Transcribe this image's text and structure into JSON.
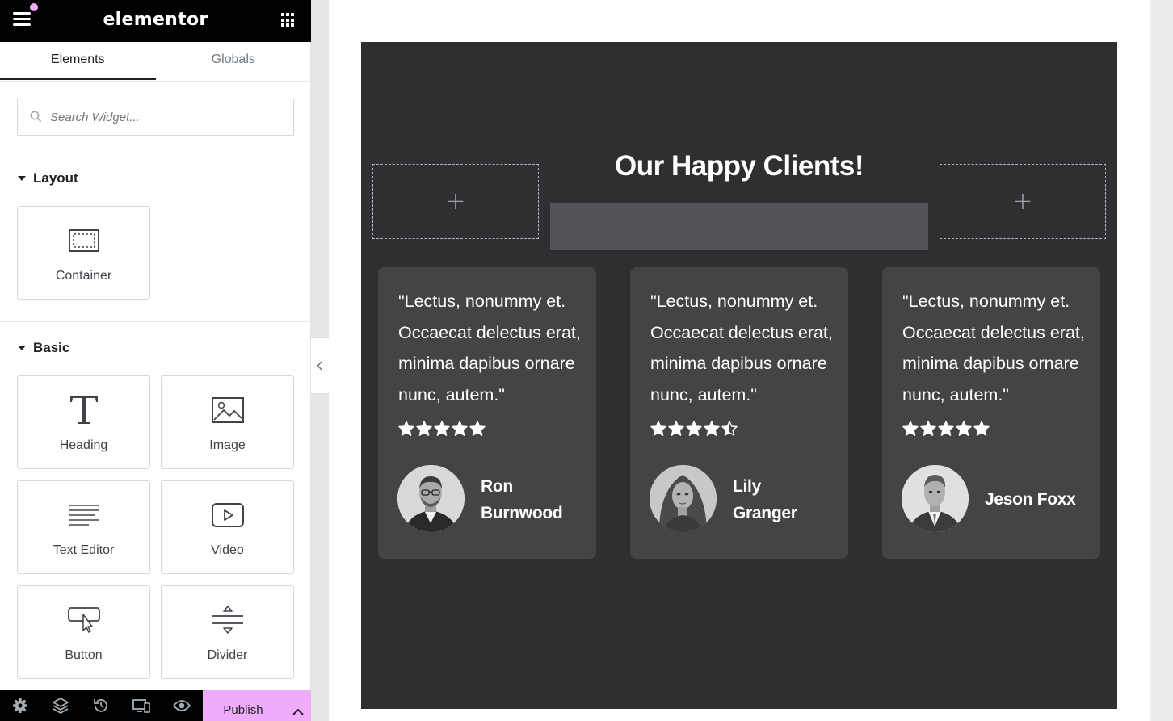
{
  "editor": {
    "brand": "elementor",
    "tabs": [
      {
        "label": "Elements",
        "active": true
      },
      {
        "label": "Globals",
        "active": false
      }
    ],
    "search": {
      "placeholder": "Search Widget..."
    },
    "sections": {
      "layout": {
        "title": "Layout",
        "widgets": [
          {
            "label": "Container",
            "icon": "container-icon"
          }
        ]
      },
      "basic": {
        "title": "Basic",
        "widgets": [
          {
            "label": "Heading",
            "icon": "heading-icon"
          },
          {
            "label": "Image",
            "icon": "image-icon"
          },
          {
            "label": "Text Editor",
            "icon": "text-editor-icon"
          },
          {
            "label": "Video",
            "icon": "video-icon"
          },
          {
            "label": "Button",
            "icon": "button-icon"
          },
          {
            "label": "Divider",
            "icon": "divider-icon"
          }
        ]
      }
    },
    "footer": {
      "icons": [
        "settings-icon",
        "layers-icon",
        "history-icon",
        "responsive-icon",
        "preview-icon"
      ],
      "publish_label": "Publish"
    },
    "colors": {
      "accent": "#f0abfc",
      "topbar": "#000000"
    }
  },
  "page": {
    "heading": "Our Happy Clients!",
    "colors": {
      "section_bg": "#2f2f31",
      "card_bg": "#444446"
    },
    "testimonials": [
      {
        "quote": "\"Lectus, nonummy et. Occaecat delectus erat, minima dapibus ornare nunc, autem.\"",
        "rating": 5,
        "name_line1": "Ron",
        "name_line2": "Burnwood"
      },
      {
        "quote": "\"Lectus, nonummy et. Occaecat delectus erat, minima dapibus ornare nunc, autem.\"",
        "rating": 4.5,
        "name_line1": "Lily",
        "name_line2": "Granger"
      },
      {
        "quote": "\"Lectus, nonummy et. Occaecat delectus erat, minima dapibus ornare nunc, autem.\"",
        "rating": 5,
        "name_line1": "Jeson Foxx",
        "name_line2": ""
      }
    ]
  }
}
